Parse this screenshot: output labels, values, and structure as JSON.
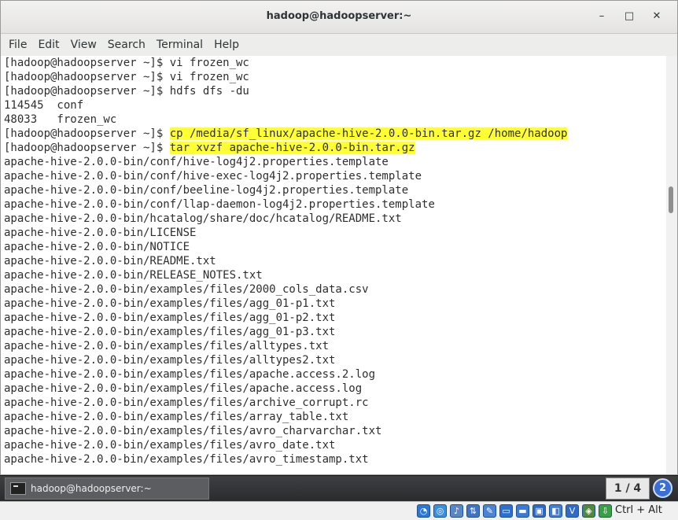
{
  "window": {
    "title": "hadoop@hadoopserver:~",
    "minimize_glyph": "–",
    "maximize_glyph": "□",
    "close_glyph": "✕"
  },
  "menu": [
    "File",
    "Edit",
    "View",
    "Search",
    "Terminal",
    "Help"
  ],
  "terminal_lines": [
    {
      "text": "[hadoop@hadoopserver ~]$ vi frozen_wc"
    },
    {
      "text": "[hadoop@hadoopserver ~]$ vi frozen_wc"
    },
    {
      "text": "[hadoop@hadoopserver ~]$ hdfs dfs -du"
    },
    {
      "text": "114545  conf"
    },
    {
      "text": "48033   frozen_wc"
    },
    {
      "prompt": "[hadoop@hadoopserver ~]$ ",
      "highlight": "cp /media/sf_linux/apache-hive-2.0.0-bin.tar.gz /home/hadoop"
    },
    {
      "prompt": "[hadoop@hadoopserver ~]$ ",
      "highlight": "tar xvzf apache-hive-2.0.0-bin.tar.gz"
    },
    {
      "text": "apache-hive-2.0.0-bin/conf/hive-log4j2.properties.template"
    },
    {
      "text": "apache-hive-2.0.0-bin/conf/hive-exec-log4j2.properties.template"
    },
    {
      "text": "apache-hive-2.0.0-bin/conf/beeline-log4j2.properties.template"
    },
    {
      "text": "apache-hive-2.0.0-bin/conf/llap-daemon-log4j2.properties.template"
    },
    {
      "text": "apache-hive-2.0.0-bin/hcatalog/share/doc/hcatalog/README.txt"
    },
    {
      "text": "apache-hive-2.0.0-bin/LICENSE"
    },
    {
      "text": "apache-hive-2.0.0-bin/NOTICE"
    },
    {
      "text": "apache-hive-2.0.0-bin/README.txt"
    },
    {
      "text": "apache-hive-2.0.0-bin/RELEASE_NOTES.txt"
    },
    {
      "text": "apache-hive-2.0.0-bin/examples/files/2000_cols_data.csv"
    },
    {
      "text": "apache-hive-2.0.0-bin/examples/files/agg_01-p1.txt"
    },
    {
      "text": "apache-hive-2.0.0-bin/examples/files/agg_01-p2.txt"
    },
    {
      "text": "apache-hive-2.0.0-bin/examples/files/agg_01-p3.txt"
    },
    {
      "text": "apache-hive-2.0.0-bin/examples/files/alltypes.txt"
    },
    {
      "text": "apache-hive-2.0.0-bin/examples/files/alltypes2.txt"
    },
    {
      "text": "apache-hive-2.0.0-bin/examples/files/apache.access.2.log"
    },
    {
      "text": "apache-hive-2.0.0-bin/examples/files/apache.access.log"
    },
    {
      "text": "apache-hive-2.0.0-bin/examples/files/archive_corrupt.rc"
    },
    {
      "text": "apache-hive-2.0.0-bin/examples/files/array_table.txt"
    },
    {
      "text": "apache-hive-2.0.0-bin/examples/files/avro_charvarchar.txt"
    },
    {
      "text": "apache-hive-2.0.0-bin/examples/files/avro_date.txt"
    },
    {
      "text": "apache-hive-2.0.0-bin/examples/files/avro_timestamp.txt"
    }
  ],
  "colors": {
    "highlight": "#ffff33",
    "terminal_bg": "#ffffff",
    "terminal_fg": "#2e2e2e"
  },
  "taskbar": {
    "task_label": "hadoop@hadoopserver:~",
    "pager": "1 / 4",
    "workspace_badge": "2"
  },
  "status_bar": {
    "tray_icons": [
      {
        "name": "hard-disk-icon",
        "color": "#2a77d4",
        "glyph": "◔"
      },
      {
        "name": "optical-drive-icon",
        "color": "#3c8ee0",
        "glyph": "◎"
      },
      {
        "name": "audio-icon",
        "color": "#5a86c4",
        "glyph": "♪"
      },
      {
        "name": "network-icon",
        "color": "#3f73c6",
        "glyph": "⇅"
      },
      {
        "name": "usb-icon",
        "color": "#4c84cf",
        "glyph": "✎"
      },
      {
        "name": "shared-folder-icon",
        "color": "#2d6fcf",
        "glyph": "▭"
      },
      {
        "name": "display-icon",
        "color": "#3a7bd5",
        "glyph": "▬"
      },
      {
        "name": "video-capture-icon",
        "color": "#2f68c2",
        "glyph": "▣"
      },
      {
        "name": "recording-icon",
        "color": "#3d7fd8",
        "glyph": "◧"
      },
      {
        "name": "cpu-icon",
        "color": "#2e6cc8",
        "glyph": "V"
      },
      {
        "name": "mouse-integration-icon",
        "color": "#4f8a3a",
        "glyph": "◈"
      },
      {
        "name": "download-icon",
        "color": "#3aa045",
        "glyph": "⇩"
      }
    ],
    "host_key": "Ctrl + Alt"
  }
}
